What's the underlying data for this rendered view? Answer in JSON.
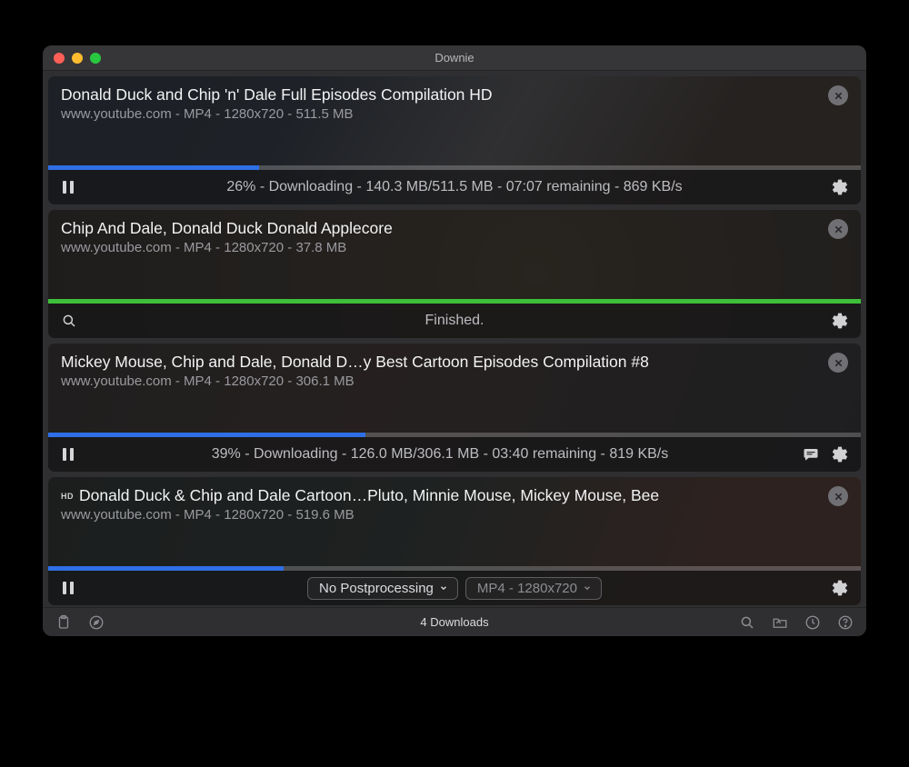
{
  "window": {
    "title": "Downie"
  },
  "items": [
    {
      "title": "Donald Duck and Chip 'n' Dale Full Episodes Compilation HD",
      "subtitle": "www.youtube.com - MP4 - 1280x720 - 511.5 MB",
      "progressPercent": 26,
      "progressColor": "blue",
      "status": "26% - Downloading - 140.3 MB/511.5 MB - 07:07 remaining - 869 KB/s",
      "leftAction": "pause",
      "rightActions": [
        "gear"
      ],
      "hd": false,
      "controls": null
    },
    {
      "title": "Chip And Dale, Donald Duck Donald Applecore",
      "subtitle": "www.youtube.com - MP4 - 1280x720 - 37.8 MB",
      "progressPercent": 100,
      "progressColor": "green",
      "status": "Finished.",
      "leftAction": "search",
      "rightActions": [
        "gear"
      ],
      "hd": false,
      "controls": null
    },
    {
      "title": "Mickey Mouse, Chip and Dale, Donald D…y Best Cartoon Episodes Compilation #8",
      "subtitle": "www.youtube.com - MP4 - 1280x720 - 306.1 MB",
      "progressPercent": 39,
      "progressColor": "blue",
      "status": "39% - Downloading - 126.0 MB/306.1 MB - 03:40 remaining - 819 KB/s",
      "leftAction": "pause",
      "rightActions": [
        "comment",
        "gear"
      ],
      "hd": false,
      "controls": null
    },
    {
      "title": "Donald Duck & Chip and Dale Cartoon…Pluto, Minnie Mouse, Mickey Mouse, Bee",
      "subtitle": "www.youtube.com - MP4 - 1280x720 - 519.6 MB",
      "progressPercent": 29,
      "progressColor": "blue",
      "status": "",
      "leftAction": "pause",
      "rightActions": [
        "gear"
      ],
      "hd": true,
      "controls": {
        "postprocess": "No Postprocessing",
        "format": "MP4 - 1280x720"
      }
    }
  ],
  "bottombar": {
    "status": "4 Downloads"
  },
  "labels": {
    "hd": "HD"
  }
}
